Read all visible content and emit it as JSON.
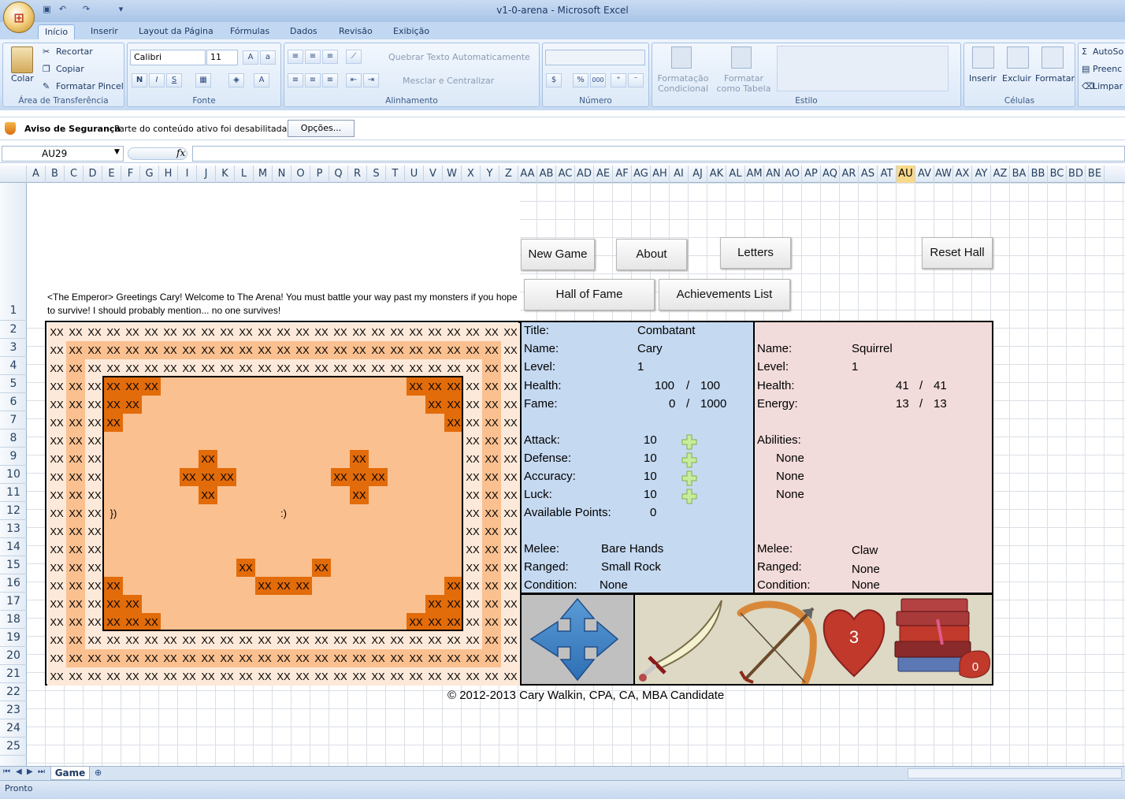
{
  "window": {
    "title": "v1-0-arena - Microsoft Excel"
  },
  "ribbon_tabs": [
    "Início",
    "Inserir",
    "Layout da Página",
    "Fórmulas",
    "Dados",
    "Revisão",
    "Exibição"
  ],
  "clipboard": {
    "paste": "Colar",
    "cut": "Recortar",
    "copy": "Copiar",
    "format_painter": "Formatar Pincel",
    "label": "Área de Transferência"
  },
  "font": {
    "name": "Calibri",
    "size": "11",
    "label": "Fonte",
    "bold": "N",
    "italic": "I",
    "underline": "S"
  },
  "alignment": {
    "wrap": "Quebrar Texto Automaticamente",
    "merge": "Mesclar e Centralizar",
    "label": "Alinhamento"
  },
  "number": {
    "label": "Número",
    "percent": "%",
    "thousands": "000"
  },
  "styles": {
    "conditional": "Formatação Condicional",
    "as_table": "Formatar como Tabela",
    "label": "Estilo"
  },
  "cells": {
    "insert": "Inserir",
    "delete": "Excluir",
    "format": "Formatar",
    "label": "Células"
  },
  "editing": {
    "autosum": "AutoSo",
    "fill": "Preenc",
    "clear": "Limpar"
  },
  "security": {
    "title": "Aviso de Segurança",
    "message": "Parte do conteúdo ativo foi desabilitada.",
    "options": "Opções..."
  },
  "formula": {
    "name_box": "AU29",
    "fx": "fx"
  },
  "columns": [
    "A",
    "B",
    "C",
    "D",
    "E",
    "F",
    "G",
    "H",
    "I",
    "J",
    "K",
    "L",
    "M",
    "N",
    "O",
    "P",
    "Q",
    "R",
    "S",
    "T",
    "U",
    "V",
    "W",
    "X",
    "Y",
    "Z",
    "AA",
    "AB",
    "AC",
    "AD",
    "AE",
    "AF",
    "AG",
    "AH",
    "AI",
    "AJ",
    "AK",
    "AL",
    "AM",
    "AN",
    "AO",
    "AP",
    "AQ",
    "AR",
    "AS",
    "AT",
    "AU",
    "AV",
    "AW",
    "AX",
    "AY",
    "AZ",
    "BA",
    "BB",
    "BC",
    "BD",
    "BE"
  ],
  "selected_column": "AU",
  "rows": [
    "1",
    "2",
    "3",
    "4",
    "5",
    "6",
    "7",
    "8",
    "9",
    "10",
    "11",
    "12",
    "13",
    "14",
    "15",
    "16",
    "17",
    "18",
    "19",
    "20",
    "21",
    "22",
    "23",
    "24",
    "25"
  ],
  "emperor_text": "<The Emperor> Greetings Cary! Welcome to The Arena! You must battle your way past my monsters if you hope to survive! I should probably mention... no one survives!",
  "buttons": {
    "new_game": "New Game",
    "about": "About",
    "letters": "Letters",
    "reset_hall": "Reset Hall",
    "hall_of_fame": "Hall of Fame",
    "achievements": "Achievements List"
  },
  "arena": {
    "tile": "XX",
    "player_icon": "})",
    "enemy_icon": ":)"
  },
  "player": {
    "title_label": "Title:",
    "title": "Combatant",
    "name_label": "Name:",
    "name": "Cary",
    "level_label": "Level:",
    "level": "1",
    "health_label": "Health:",
    "health": "100",
    "health_max": "100",
    "fame_label": "Fame:",
    "fame": "0",
    "fame_max": "1000",
    "attack_label": "Attack:",
    "attack": "10",
    "defense_label": "Defense:",
    "defense": "10",
    "accuracy_label": "Accuracy:",
    "accuracy": "10",
    "luck_label": "Luck:",
    "luck": "10",
    "points_label": "Available Points:",
    "points": "0",
    "melee_label": "Melee:",
    "melee": "Bare Hands",
    "ranged_label": "Ranged:",
    "ranged": "Small Rock",
    "condition_label": "Condition:",
    "condition": "None",
    "slash": "/"
  },
  "monster": {
    "name_label": "Name:",
    "name": "Squirrel",
    "level_label": "Level:",
    "level": "1",
    "health_label": "Health:",
    "health": "41",
    "health_max": "41",
    "energy_label": "Energy:",
    "energy": "13",
    "energy_max": "13",
    "abilities_label": "Abilities:",
    "abilities": [
      "None",
      "None",
      "None"
    ],
    "melee_label": "Melee:",
    "melee": "Claw",
    "ranged_label": "Ranged:",
    "ranged": "None",
    "condition_label": "Condition:",
    "condition": "None",
    "slash": "/"
  },
  "actions": {
    "potions": "3",
    "books": "0"
  },
  "copyright": "© 2012-2013 Cary Walkin, CPA, CA, MBA Candidate",
  "sheet_tab": "Game",
  "status": "Pronto",
  "colors": {
    "arena_light": "#fde9d9",
    "arena_mid": "#fac090",
    "arena_dark": "#e26b0a",
    "player_panel": "#c5d9f1",
    "monster_panel": "#f2dcdb"
  }
}
